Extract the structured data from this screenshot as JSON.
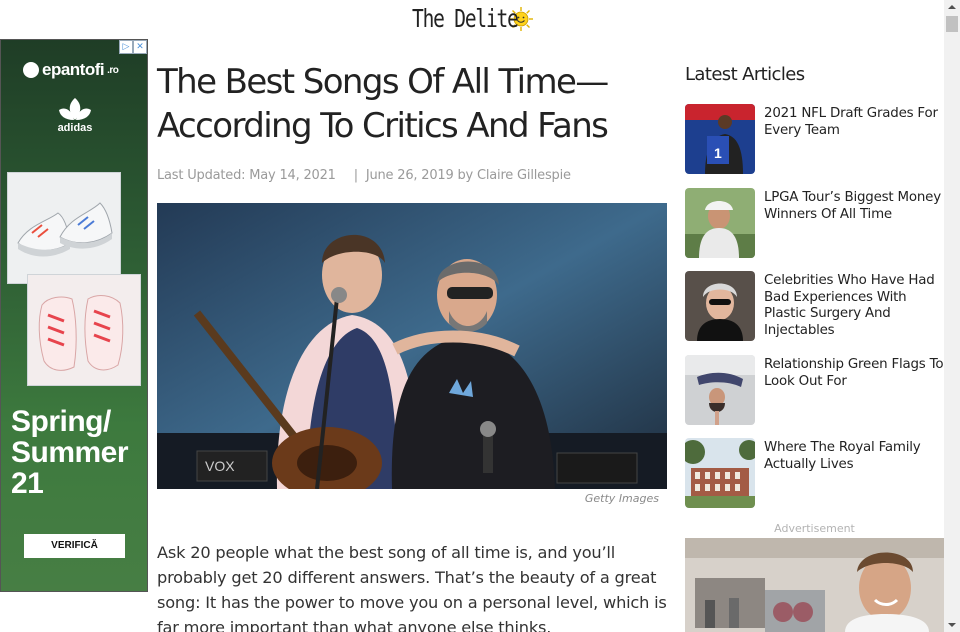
{
  "site": {
    "name": "The Delite"
  },
  "left_ad": {
    "brand": "epantofi",
    "brand_tld": ".ro",
    "sub_brand": "adidas",
    "headline_lines": [
      "Spring/",
      "Summer",
      "21"
    ],
    "cta": "VERIFICĂ"
  },
  "article": {
    "title": "The Best Songs Of All Time—According To Critics And Fans",
    "last_updated": "Last Updated: May 14, 2021",
    "separator": "|",
    "published": "June 26, 2019",
    "by": "by",
    "author": "Claire Gillespie",
    "image_caption": "Getty Images",
    "body": "Ask 20 people what the best song of all time is, and you’ll probably get 20 different answers. That’s the beauty of a great song: It has the power to move you on a personal level, which is far more important than what anyone else thinks."
  },
  "sidebar": {
    "heading": "Latest Articles",
    "items": [
      {
        "title": "2021 NFL Draft Grades For Every Team"
      },
      {
        "title": "LPGA Tour’s Biggest Money Winners Of All Time"
      },
      {
        "title": "Celebrities Who Have Had Bad Experiences With Plastic Surgery And Injectables"
      },
      {
        "title": "Relationship Green Flags To Look Out For"
      },
      {
        "title": "Where The Royal Family Actually Lives"
      }
    ],
    "ad_label": "Advertisement"
  },
  "colors": {
    "meta_gray": "#9a9a9a",
    "ad_green": "#2c5a33",
    "scrollbar_thumb": "#c1c1c1"
  }
}
